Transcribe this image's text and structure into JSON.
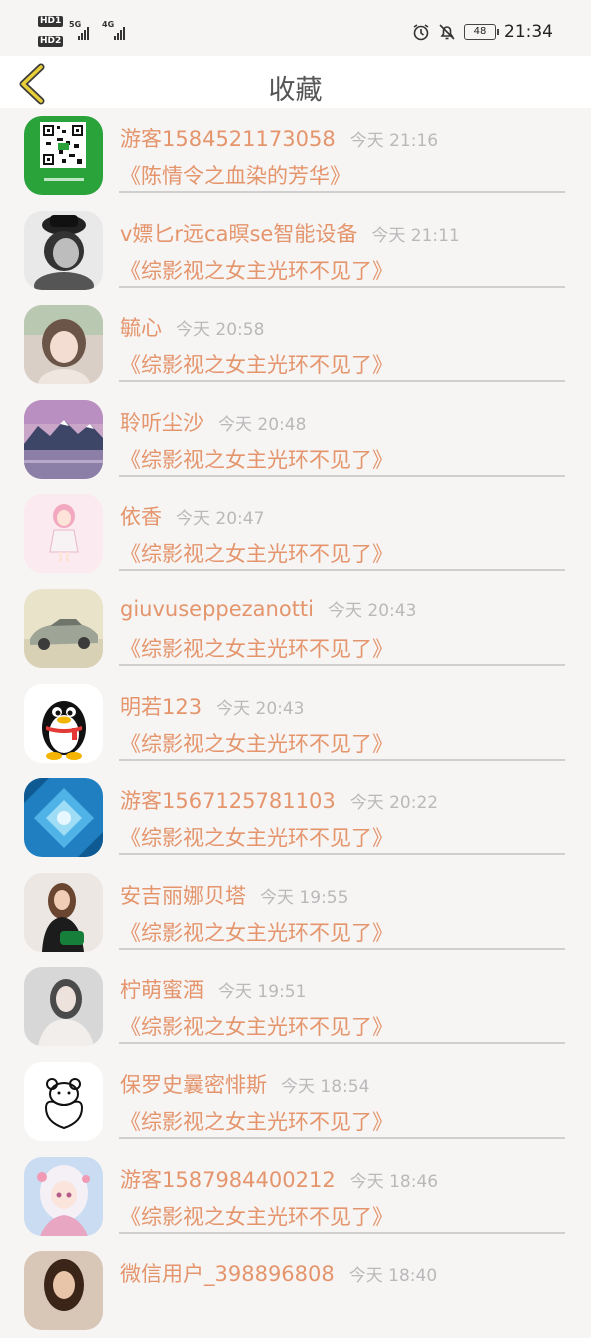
{
  "status_bar": {
    "hd1": "HD1",
    "hd2": "HD2",
    "net1": "5G",
    "net2": "4G",
    "battery": "48",
    "time": "21:34"
  },
  "header": {
    "title": "收藏"
  },
  "favorites": [
    {
      "nickname": "游客1584521173058",
      "time": "今天 21:16",
      "book": "《陈情令之血染的芳华》",
      "avatar": "qr-code"
    },
    {
      "nickname": "v嫖匕r远ca暝se智能设备",
      "time": "今天 21:11",
      "book": "《综影视之女主光环不见了》",
      "avatar": "bw-portrait"
    },
    {
      "nickname": "毓心",
      "time": "今天 20:58",
      "book": "《综影视之女主光环不见了》",
      "avatar": "girl-photo"
    },
    {
      "nickname": "聆听尘沙",
      "time": "今天 20:48",
      "book": "《综影视之女主光环不见了》",
      "avatar": "mountain-lake"
    },
    {
      "nickname": "依香",
      "time": "今天 20:47",
      "book": "《综影视之女主光环不见了》",
      "avatar": "pink-doll"
    },
    {
      "nickname": "giuvuseppezanotti",
      "time": "今天 20:43",
      "book": "《综影视之女主光环不见了》",
      "avatar": "sports-car"
    },
    {
      "nickname": "明若123",
      "time": "今天 20:43",
      "book": "《综影视之女主光环不见了》",
      "avatar": "qq-penguin"
    },
    {
      "nickname": "游客1567125781103",
      "time": "今天 20:22",
      "book": "《综影视之女主光环不见了》",
      "avatar": "blue-abstract"
    },
    {
      "nickname": "安吉丽娜贝塔",
      "time": "今天 19:55",
      "book": "《综影视之女主光环不见了》",
      "avatar": "woman-green-bag"
    },
    {
      "nickname": "柠萌蜜酒",
      "time": "今天 19:51",
      "book": "《综影视之女主光环不见了》",
      "avatar": "woman-portrait"
    },
    {
      "nickname": "保罗史曩密悱斯",
      "time": "今天 18:54",
      "book": "《综影视之女主光环不见了》",
      "avatar": "bear-sketch"
    },
    {
      "nickname": "游客1587984400212",
      "time": "今天 18:46",
      "book": "《综影视之女主光环不见了》",
      "avatar": "anime-girl"
    },
    {
      "nickname": "微信用户_398896808",
      "time": "今天 18:40",
      "book": "",
      "avatar": "woman-partial"
    }
  ],
  "colors": {
    "accent": "#e4956c",
    "back_arrow": "#e8cf3a",
    "time_text": "#b9b9b9",
    "divider": "#cfcfcf"
  }
}
